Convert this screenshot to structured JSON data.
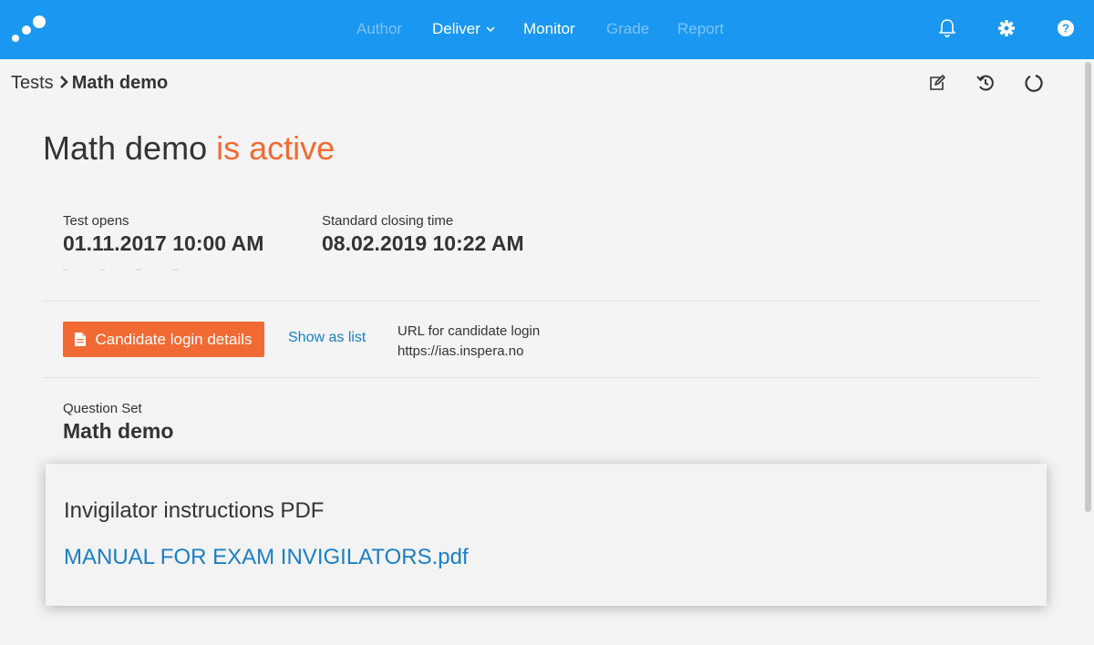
{
  "topbar": {
    "background": "#1a97f0",
    "logo_icon": "dots-logo-icon",
    "nav": [
      {
        "label": "Author",
        "disabled": true
      },
      {
        "label": "Deliver",
        "disabled": false,
        "dropdown": true
      },
      {
        "label": "Monitor",
        "disabled": false
      },
      {
        "label": "Grade",
        "disabled": true
      },
      {
        "label": "Report",
        "disabled": true
      }
    ],
    "icons": [
      "bell-icon",
      "gear-icon",
      "help-icon"
    ]
  },
  "breadcrumb": {
    "parent": "Tests",
    "current": "Math demo"
  },
  "toolbar": {
    "icons": [
      "edit-icon",
      "history-icon",
      "refresh-icon"
    ]
  },
  "header": {
    "title": "Math demo",
    "status": "is active",
    "status_color": "#f26a33"
  },
  "schedule": {
    "opens_label": "Test opens",
    "opens_value": "01.11.2017 10:00 AM",
    "closing_label": "Standard closing time",
    "closing_value": "08.02.2019 10:22 AM"
  },
  "login": {
    "button_label": "Candidate login details",
    "button_icon": "document-icon",
    "button_color": "#f26a33",
    "show_list_label": "Show as list",
    "url_label": "URL for candidate login",
    "url_value": "https://ias.inspera.no"
  },
  "question_set": {
    "label": "Question Set",
    "value": "Math demo"
  },
  "popup": {
    "title": "Invigilator instructions PDF",
    "link": "MANUAL FOR EXAM INVIGILATORS.pdf",
    "link_color": "#1a7fc4"
  }
}
